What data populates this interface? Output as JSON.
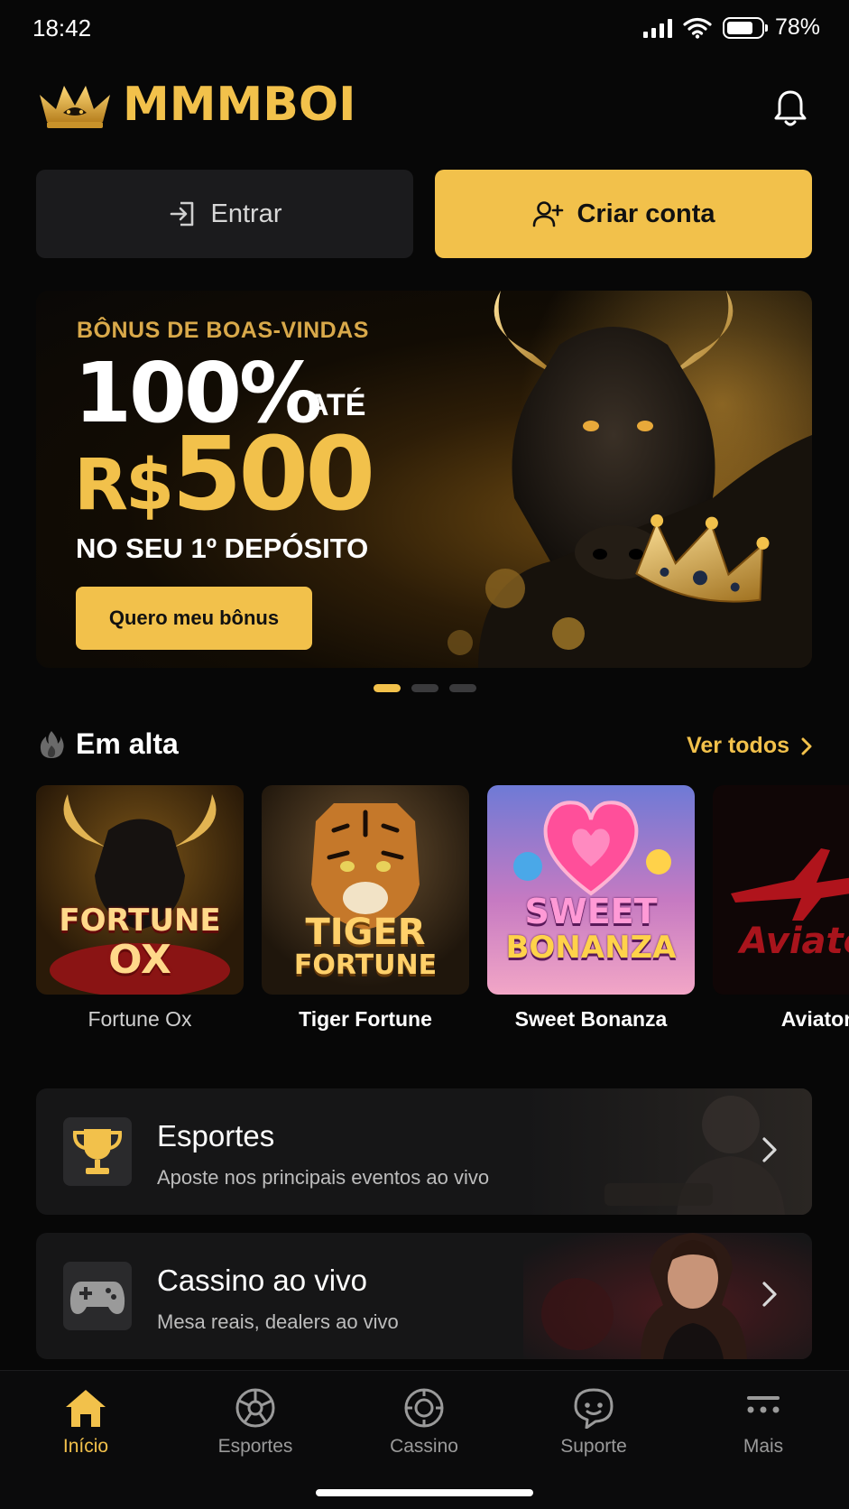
{
  "status": {
    "time": "18:42",
    "battery": "78%",
    "battery_level": 0.78
  },
  "header": {
    "brand": "MMMBOI"
  },
  "auth": {
    "enter_label": "Entrar",
    "create_label": "Criar conta"
  },
  "banner": {
    "kicker": "BÔNUS DE BOAS-VINDAS",
    "percent": "100%",
    "up_to": "ATÉ",
    "currency": "R$",
    "amount": "500",
    "subtitle": "NO SEU 1º DEPÓSITO",
    "cta": "Quero meu bônus",
    "slides": 3,
    "active_slide": 1
  },
  "trending": {
    "title": "Em alta",
    "see_all": "Ver todos",
    "games": [
      {
        "name": "Fortune Ox",
        "art_line1": "FORTUNE",
        "art_line2": "OX"
      },
      {
        "name": "Tiger Fortune",
        "art_line1": "TIGER",
        "art_line2": "FORTUNE"
      },
      {
        "name": "Sweet Bonanza",
        "art_line1": "SWEET",
        "art_line2": "BONANZA"
      },
      {
        "name": "Aviator",
        "art_line1": "Aviato"
      }
    ]
  },
  "categories": [
    {
      "title": "Esportes",
      "desc": "Aposte nos principais eventos ao vivo",
      "icon": "trophy-icon"
    },
    {
      "title": "Cassino ao vivo",
      "desc": "Mesa reais, dealers ao vivo",
      "icon": "gamepad-icon"
    }
  ],
  "nav": [
    {
      "label": "Início",
      "icon": "home-icon",
      "active": true
    },
    {
      "label": "Esportes",
      "icon": "soccer-ball-icon",
      "active": false
    },
    {
      "label": "Cassino",
      "icon": "casino-chip-icon",
      "active": false
    },
    {
      "label": "Suporte",
      "icon": "chat-support-icon",
      "active": false
    },
    {
      "label": "Mais",
      "icon": "menu-more-icon",
      "active": false
    }
  ],
  "colors": {
    "accent": "#f2c14b",
    "background": "#070707",
    "card": "#161617"
  }
}
